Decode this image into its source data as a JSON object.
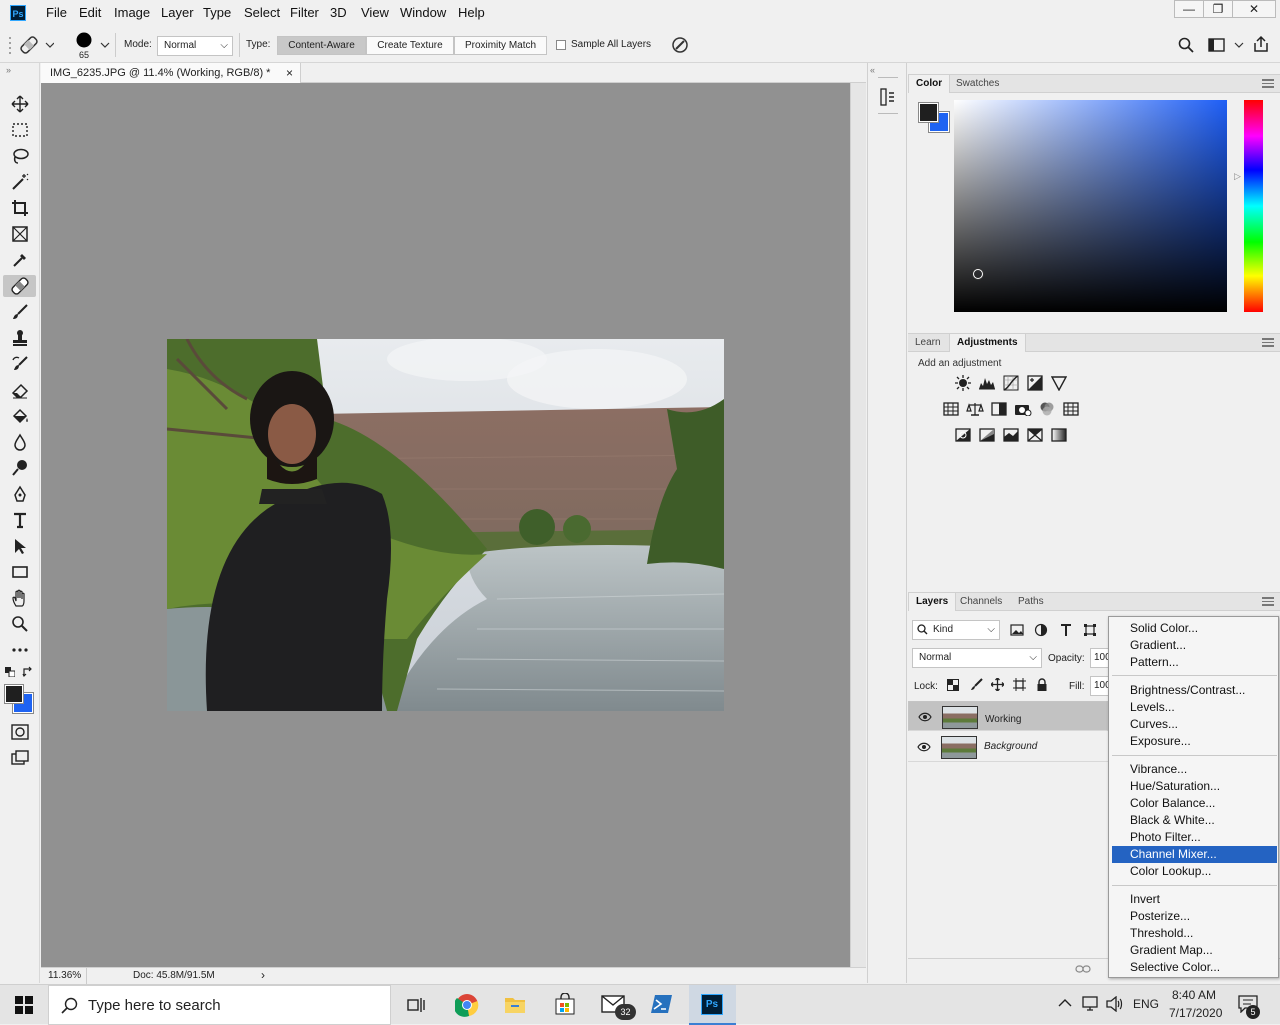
{
  "app": {
    "logo": "Ps",
    "menu": [
      "File",
      "Edit",
      "Image",
      "Layer",
      "Type",
      "Select",
      "Filter",
      "3D",
      "View",
      "Window",
      "Help"
    ],
    "window_buttons": [
      "—",
      "❐",
      "✕"
    ]
  },
  "options": {
    "brush_size": "65",
    "mode_label": "Mode:",
    "mode_value": "Normal",
    "type_label": "Type:",
    "type_buttons": [
      "Content-Aware",
      "Create Texture",
      "Proximity Match"
    ],
    "sample_all_layers": "Sample All Layers"
  },
  "document": {
    "tab_title": "IMG_6235.JPG @ 11.4% (Working, RGB/8) *",
    "tab_close": "×",
    "zoom": "11.36%",
    "doc_size": "Doc: 45.8M/91.5M",
    "status_arrow": "›"
  },
  "color_panel": {
    "tabs": [
      "Color",
      "Swatches"
    ],
    "foreground": "#1f1f1f",
    "background": "#1e63f2",
    "field_hue": "#1e5ef5"
  },
  "adjust_panel": {
    "tabs": [
      "Learn",
      "Adjustments"
    ],
    "heading": "Add an adjustment"
  },
  "layers_panel": {
    "tabs": [
      "Layers",
      "Channels",
      "Paths"
    ],
    "filter_kind": "Kind",
    "blend_mode": "Normal",
    "opacity_label": "Opacity:",
    "opacity_value": "100",
    "lock_label": "Lock:",
    "fill_label": "Fill:",
    "fill_value": "100",
    "layers": [
      {
        "name": "Working",
        "selected": true
      },
      {
        "name": "Background",
        "selected": false
      }
    ]
  },
  "context_menu": {
    "items": [
      "Solid Color...",
      "Gradient...",
      "Pattern...",
      "Brightness/Contrast...",
      "Levels...",
      "Curves...",
      "Exposure...",
      "Vibrance...",
      "Hue/Saturation...",
      "Color Balance...",
      "Black & White...",
      "Photo Filter...",
      "Channel Mixer...",
      "Color Lookup...",
      "Invert",
      "Posterize...",
      "Threshold...",
      "Gradient Map...",
      "Selective Color..."
    ],
    "highlighted": "Channel Mixer..."
  },
  "taskbar": {
    "search_placeholder": "Type here to search",
    "mail_badge": "32",
    "language": "ENG",
    "time": "8:40 AM",
    "date": "7/17/2020",
    "notification_count": "5"
  }
}
